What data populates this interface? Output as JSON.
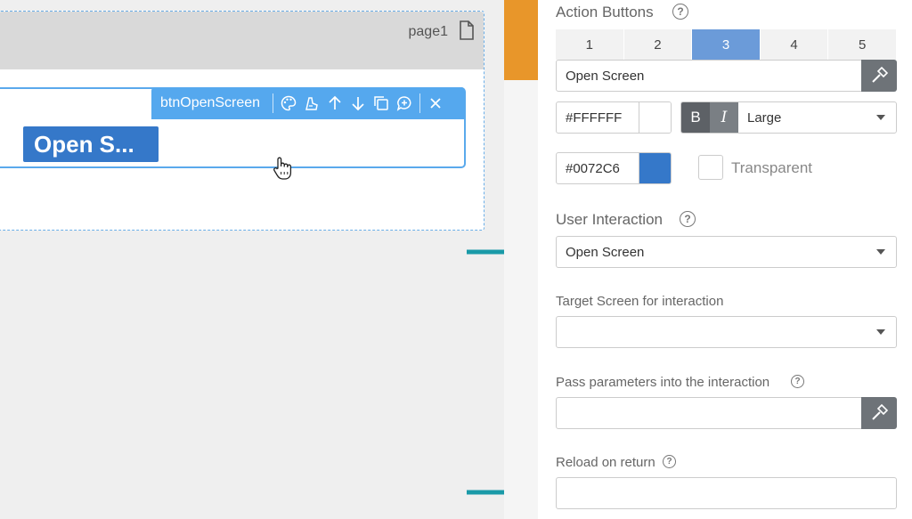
{
  "canvas": {
    "page_name": "page1",
    "selected_component": "btnOpenScreen",
    "button_text": "Open S..."
  },
  "panel": {
    "action_buttons_title": "Action Buttons",
    "tabs": [
      "1",
      "2",
      "3",
      "4",
      "5"
    ],
    "active_tab": "3",
    "button_label_value": "Open Screen",
    "text_color": "#FFFFFF",
    "bold_label": "B",
    "italic_label": "I",
    "font_size": "Large",
    "bg_color": "#0072C6",
    "transparent_label": "Transparent",
    "user_interaction_title": "User Interaction",
    "user_interaction_value": "Open Screen",
    "target_screen_label": "Target Screen for interaction",
    "target_screen_value": "",
    "pass_params_label": "Pass parameters into the interaction",
    "pass_params_value": "",
    "reload_label": "Reload on return",
    "reload_value": ""
  },
  "colors": {
    "accent": "#55a8ee",
    "button_bg": "#0072C6",
    "tab_active": "#6b9bd9",
    "orange": "#e8962a",
    "arrow": "#1a9aa8"
  },
  "icons": [
    "page-icon",
    "palette-icon",
    "style-icon",
    "arrow-up-icon",
    "arrow-down-icon",
    "copy-icon",
    "comment-add-icon",
    "close-icon",
    "hammer-icon",
    "help-icon",
    "hand-cursor-icon"
  ]
}
